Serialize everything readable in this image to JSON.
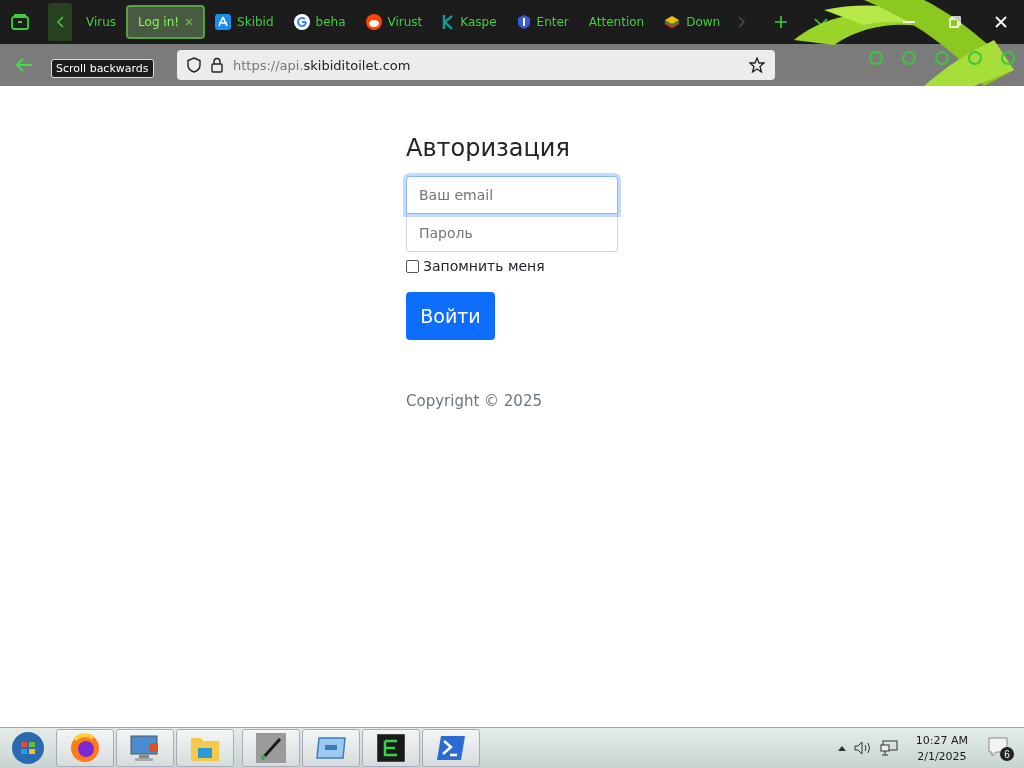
{
  "browser": {
    "tabs": [
      {
        "label": "Virus",
        "selected": false
      },
      {
        "label": "Log in!",
        "selected": true
      },
      {
        "label": "Skibid",
        "selected": false
      },
      {
        "label": "beha",
        "selected": false
      },
      {
        "label": "Virust",
        "selected": false
      },
      {
        "label": "Kaspe",
        "selected": false
      },
      {
        "label": "Enter",
        "selected": false
      },
      {
        "label": "Attention",
        "selected": false
      },
      {
        "label": "Down",
        "selected": false
      }
    ],
    "tooltip": "Scroll backwards",
    "address": {
      "prefix": "https://api.",
      "host": "skibiditoilet.com"
    }
  },
  "page": {
    "title": "Авторизация",
    "email": {
      "placeholder": "Ваш email",
      "focused": true
    },
    "password": {
      "placeholder": "Пароль"
    },
    "remember": {
      "label": "Запомнить меня",
      "checked": false
    },
    "submit": "Войти",
    "footer": "Copyright © 2025"
  },
  "taskbar": {
    "time": "10:27 AM",
    "date": "2/1/2025",
    "notifications": "6"
  }
}
